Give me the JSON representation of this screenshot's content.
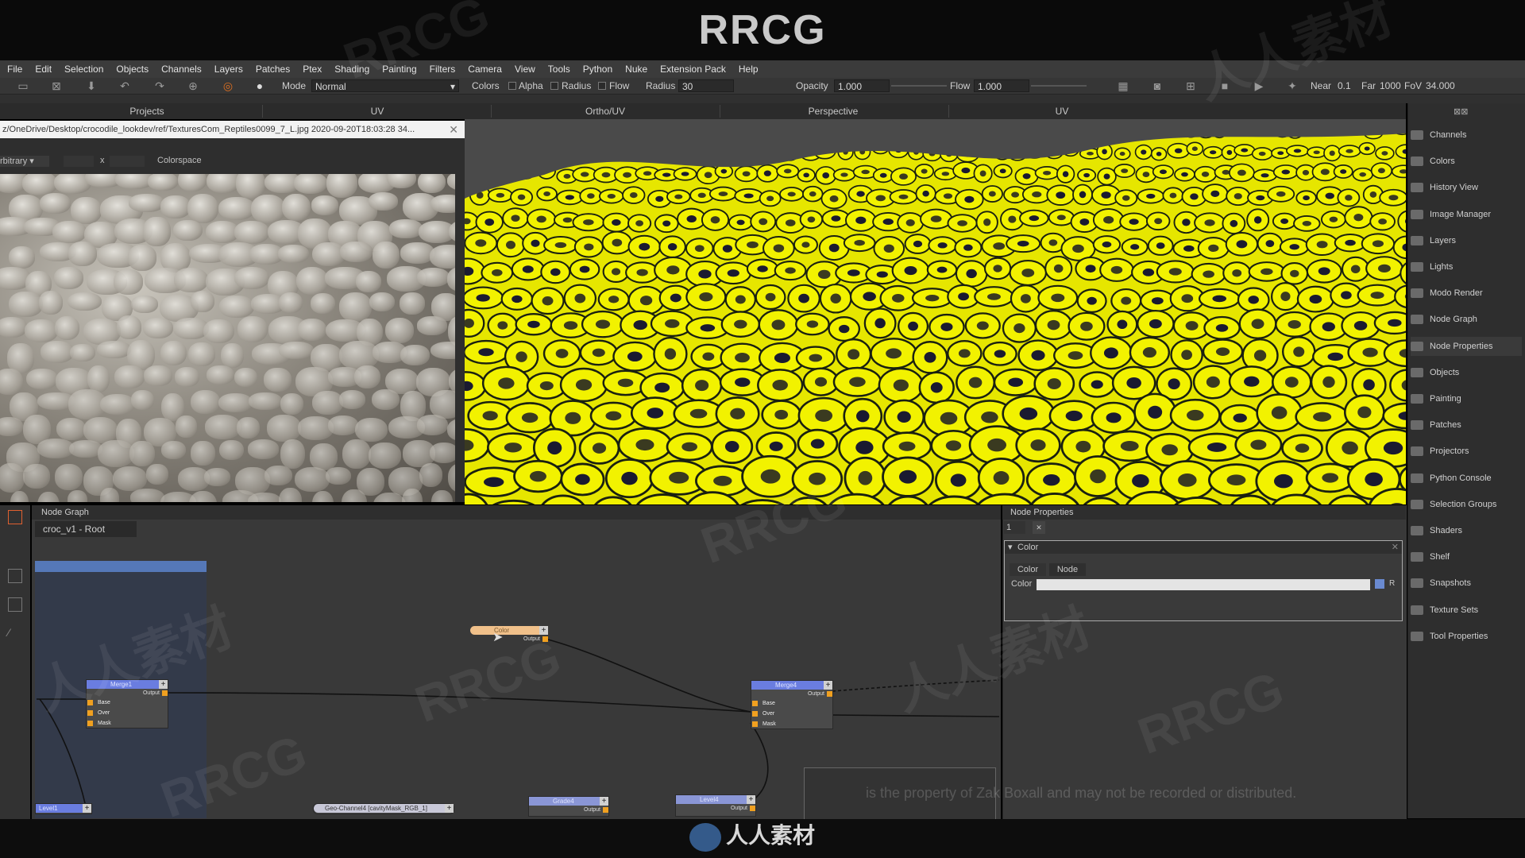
{
  "banner": {
    "brand": "RRCG",
    "bottom_logo": "人人素材"
  },
  "menu": [
    "File",
    "Edit",
    "Selection",
    "Objects",
    "Channels",
    "Layers",
    "Patches",
    "Ptex",
    "Shading",
    "Painting",
    "Filters",
    "Camera",
    "View",
    "Tools",
    "Python",
    "Nuke",
    "Extension Pack",
    "Help"
  ],
  "toolbar": {
    "mode_label": "Mode",
    "mode_value": "Normal",
    "colors_label": "Colors",
    "alpha_label": "Alpha",
    "radius_check_label": "Radius",
    "flow_check_label": "Flow",
    "radius_label": "Radius",
    "radius_value": "30",
    "opacity_label": "Opacity",
    "opacity_value": "1.000",
    "flow_label": "Flow",
    "flow_value": "1.000",
    "near_label": "Near",
    "near_value": "0.1",
    "far_label": "Far",
    "far_value": "1000",
    "fov_label": "FoV",
    "fov_value": "34.000"
  },
  "view_tabs": [
    "Projects",
    "UV",
    "Ortho/UV",
    "Perspective",
    "UV"
  ],
  "image_panel": {
    "title": "z/OneDrive/Desktop/crocodile_lookdev/ref/TexturesCom_Reptiles0099_7_L.jpg 2020-09-20T18:03:28 34...",
    "arbitrary": "rbitrary",
    "x_label": "x",
    "colorspace_label": "Colorspace"
  },
  "right_panel": [
    {
      "label": "Channels",
      "icon": "channels-icon"
    },
    {
      "label": "Colors",
      "icon": "colors-icon"
    },
    {
      "label": "History View",
      "icon": "history-icon"
    },
    {
      "label": "Image Manager",
      "icon": "image-manager-icon"
    },
    {
      "label": "Layers",
      "icon": "layers-icon"
    },
    {
      "label": "Lights",
      "icon": "lights-icon"
    },
    {
      "label": "Modo Render",
      "icon": "modo-render-icon"
    },
    {
      "label": "Node Graph",
      "icon": "node-graph-icon"
    },
    {
      "label": "Node Properties",
      "icon": "node-properties-icon"
    },
    {
      "label": "Objects",
      "icon": "objects-icon"
    },
    {
      "label": "Painting",
      "icon": "painting-icon"
    },
    {
      "label": "Patches",
      "icon": "patches-icon"
    },
    {
      "label": "Projectors",
      "icon": "projectors-icon"
    },
    {
      "label": "Python Console",
      "icon": "python-console-icon"
    },
    {
      "label": "Selection Groups",
      "icon": "selection-groups-icon"
    },
    {
      "label": "Shaders",
      "icon": "shaders-icon"
    },
    {
      "label": "Shelf",
      "icon": "shelf-icon"
    },
    {
      "label": "Snapshots",
      "icon": "snapshots-icon"
    },
    {
      "label": "Texture Sets",
      "icon": "texture-sets-icon"
    },
    {
      "label": "Tool Properties",
      "icon": "tool-properties-icon"
    }
  ],
  "node_graph": {
    "header": "Node Graph",
    "tab": "croc_v1 - Root",
    "nodes": {
      "merge_left": {
        "title": "Merge1",
        "inputs": [
          "Base",
          "Over",
          "Mask"
        ],
        "output": "Output"
      },
      "color": {
        "title": "Color",
        "output": "Output"
      },
      "merge_right": {
        "title": "Merge4",
        "inputs": [
          "Base",
          "Over",
          "Mask"
        ],
        "output": "Output"
      },
      "level_left": {
        "title": "Level1"
      },
      "channel": {
        "title": "Geo-Channel4 [cavityMask_RGB_1]"
      },
      "small1": {
        "title": "Grade4",
        "output": "Output"
      },
      "small2": {
        "title": "Level4",
        "output": "Output"
      }
    }
  },
  "node_properties": {
    "header": "Node Properties",
    "index": "1",
    "section": "Color",
    "tabs": [
      "Color",
      "Node"
    ],
    "color_label": "Color",
    "r_label": "R"
  },
  "copyright": "is the property of Zak Boxall and may not be recorded or distributed.",
  "watermarks": [
    "RRCG",
    "人人素材",
    "RRCG",
    "人人素材",
    "RRCG",
    "RRCG",
    "人人素材",
    "RRCG"
  ]
}
